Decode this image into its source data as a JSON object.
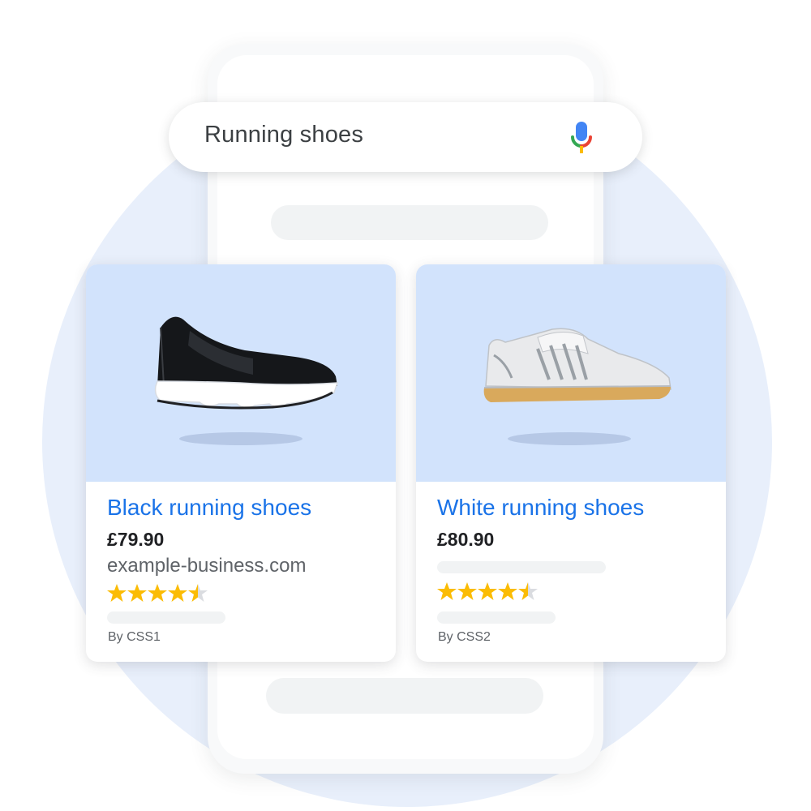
{
  "search": {
    "query": "Running shoes",
    "mic_icon": "mic-icon"
  },
  "products": [
    {
      "title": "Black running shoes",
      "price": "£79.90",
      "domain": "example-business.com",
      "rating": 4.5,
      "rating_max": 5,
      "byline": "By CSS1",
      "image_icon": "black-shoe-image"
    },
    {
      "title": "White running shoes",
      "price": "£80.90",
      "rating": 4.5,
      "rating_max": 5,
      "byline": "By CSS2",
      "image_icon": "white-shoe-image"
    }
  ],
  "colors": {
    "accent_blue": "#1a73e8",
    "star_gold": "#fbbc04",
    "card_image_bg": "#d2e3fc",
    "background_circle": "#e8effb"
  }
}
